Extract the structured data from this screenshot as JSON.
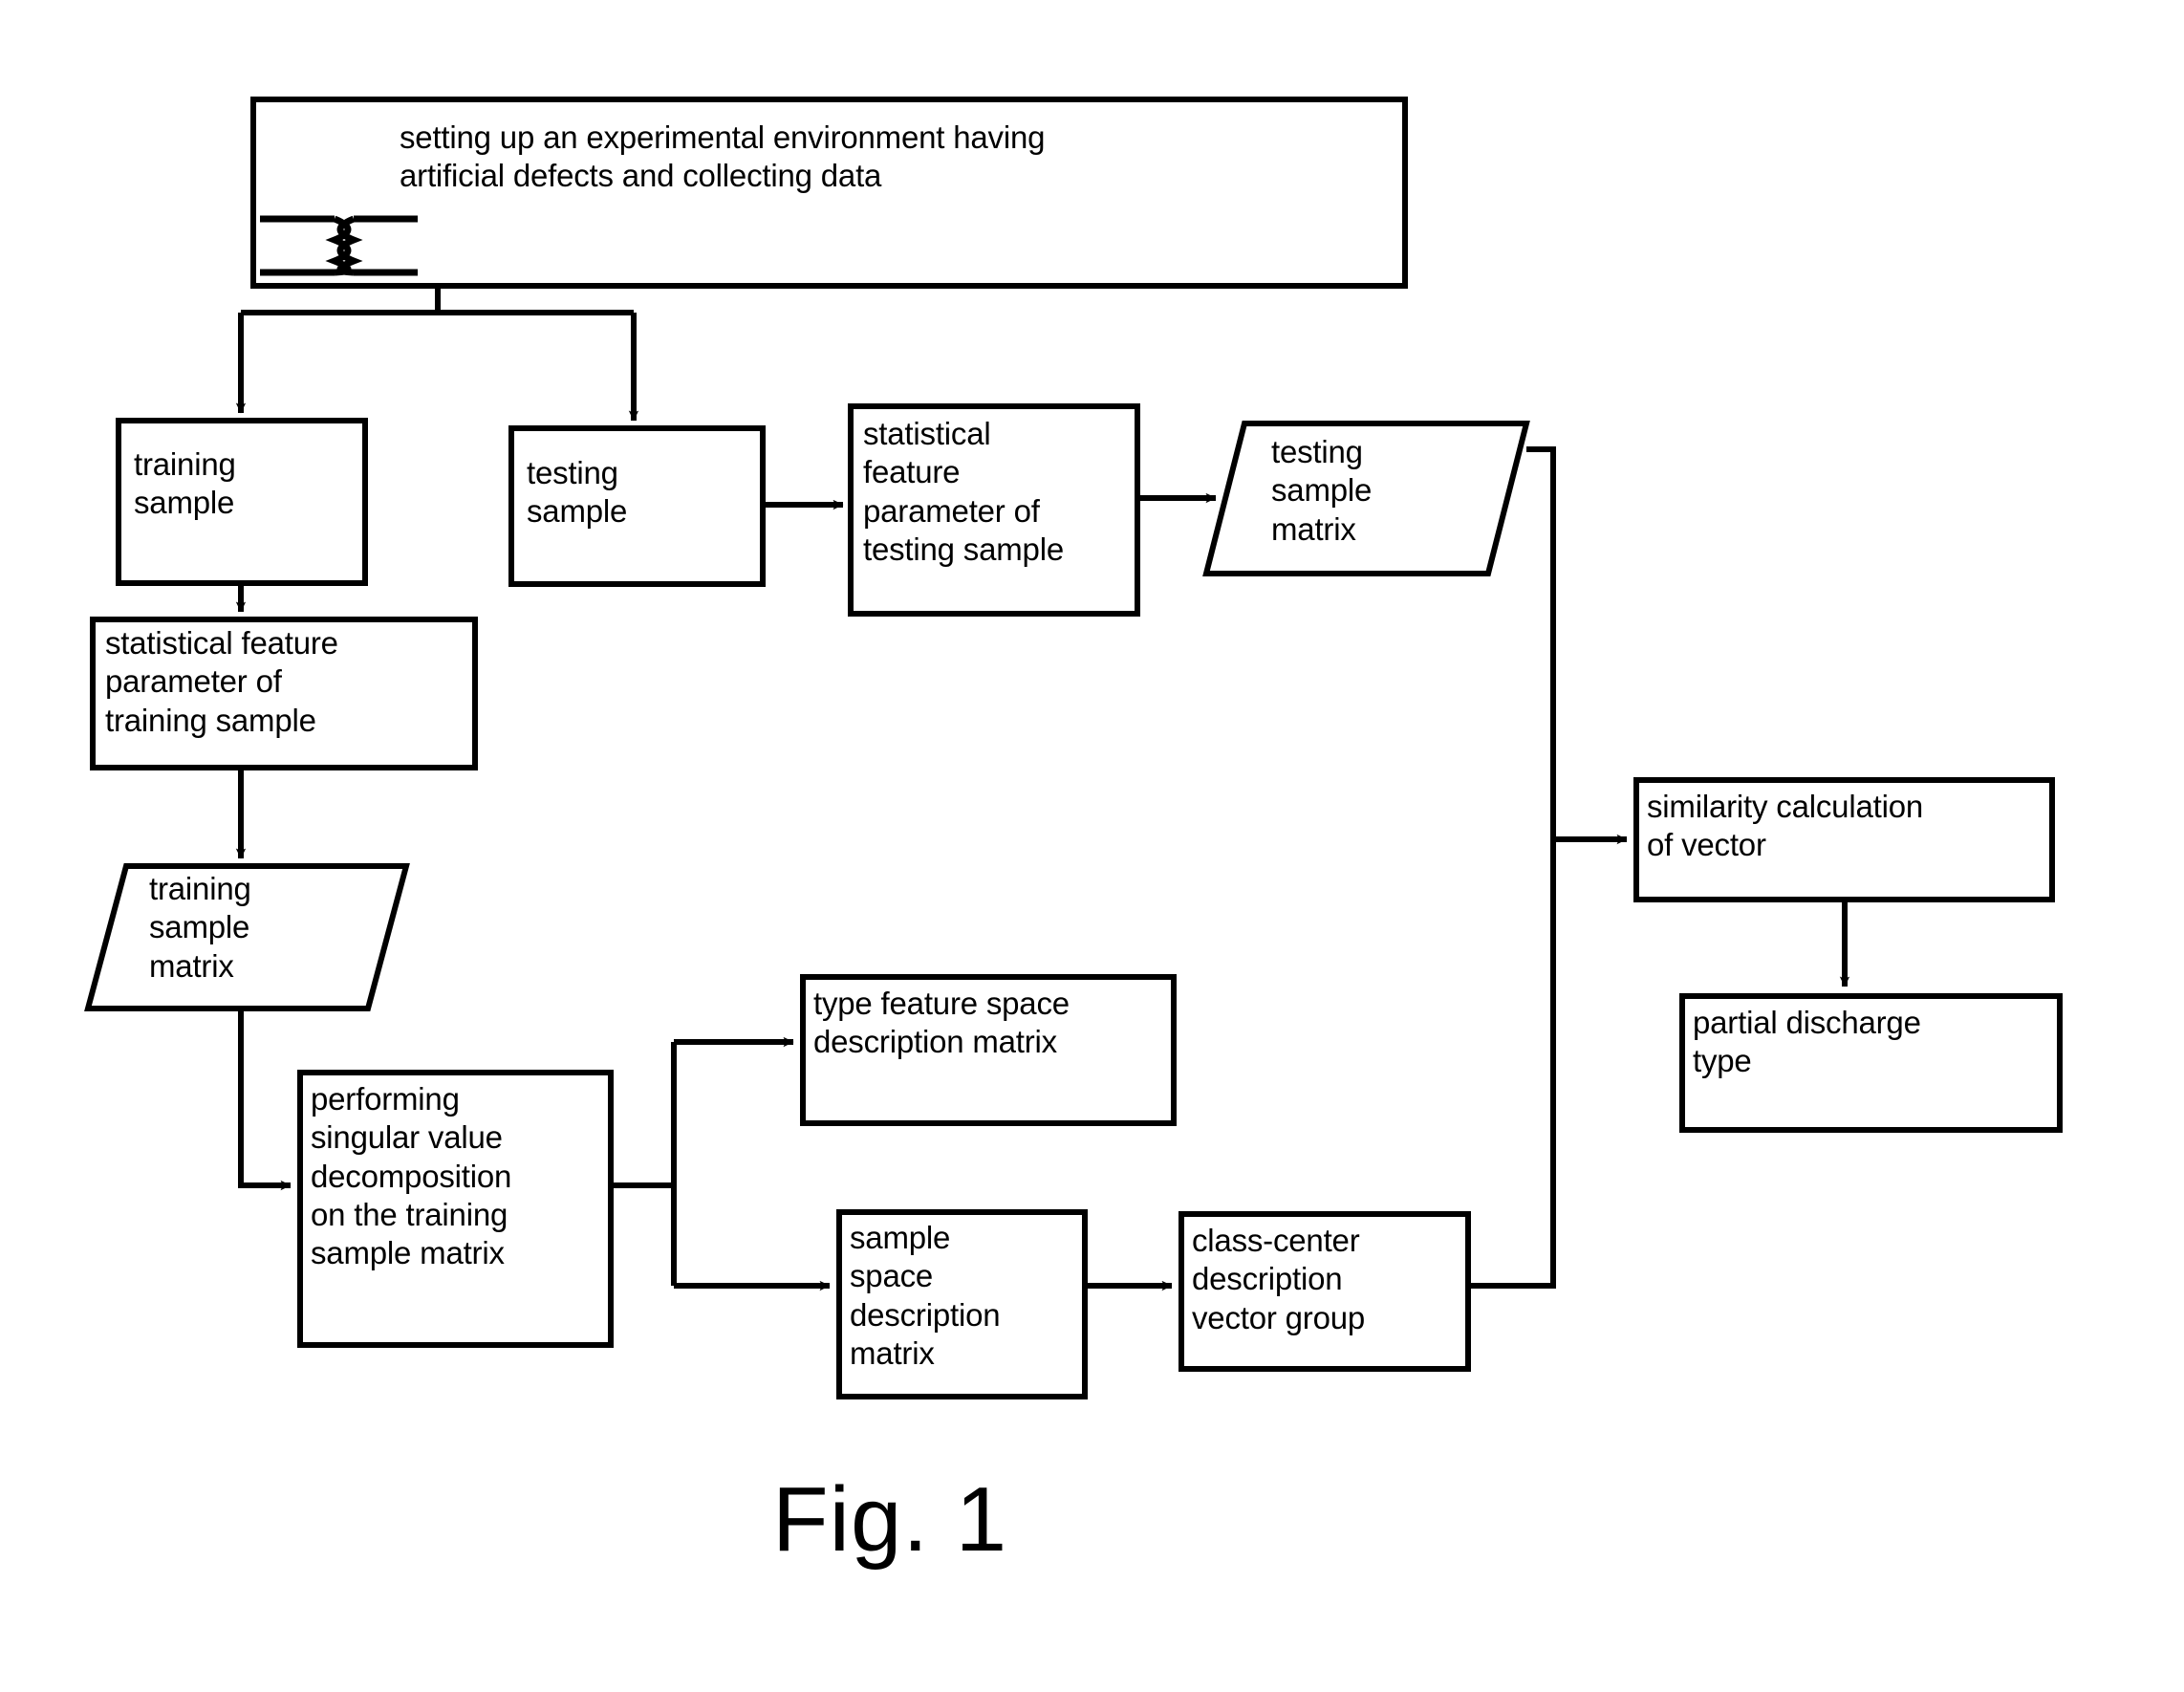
{
  "figure": {
    "caption": "Fig. 1",
    "stroke_color": "#000000",
    "background_color": "#ffffff"
  },
  "nodes": {
    "setup": {
      "label": "setting up an experimental environment having\nartificial defects and collecting data",
      "shape": "rect",
      "icon": "transformer-coil-icon"
    },
    "training_sample": {
      "label": "training\nsample",
      "shape": "rect"
    },
    "testing_sample": {
      "label": "testing\nsample",
      "shape": "rect"
    },
    "stat_feature_testing": {
      "label": "statistical\nfeature\nparameter of\ntesting sample",
      "shape": "rect"
    },
    "testing_sample_matrix": {
      "label": "testing\nsample\nmatrix",
      "shape": "parallelogram"
    },
    "stat_feature_training": {
      "label": "statistical feature\nparameter of\ntraining sample",
      "shape": "rect"
    },
    "training_sample_matrix": {
      "label": "training\nsample\nmatrix",
      "shape": "parallelogram"
    },
    "svd": {
      "label": "performing\nsingular value\ndecomposition\non the training\nsample matrix",
      "shape": "rect"
    },
    "type_feature_space": {
      "label": "type feature space\ndescription matrix",
      "shape": "rect"
    },
    "sample_space": {
      "label": "sample\nspace\ndescription\nmatrix",
      "shape": "rect"
    },
    "class_center": {
      "label": "class-center\ndescription\nvector group",
      "shape": "rect"
    },
    "similarity": {
      "label": "similarity calculation\nof vector",
      "shape": "rect"
    },
    "partial_discharge": {
      "label": "partial discharge\ntype",
      "shape": "rect"
    }
  },
  "edges": [
    {
      "from": "setup",
      "to": "training_sample"
    },
    {
      "from": "setup",
      "to": "testing_sample"
    },
    {
      "from": "testing_sample",
      "to": "stat_feature_testing"
    },
    {
      "from": "stat_feature_testing",
      "to": "testing_sample_matrix"
    },
    {
      "from": "training_sample",
      "to": "stat_feature_training"
    },
    {
      "from": "stat_feature_training",
      "to": "training_sample_matrix"
    },
    {
      "from": "training_sample_matrix",
      "to": "svd"
    },
    {
      "from": "svd",
      "to": "type_feature_space"
    },
    {
      "from": "svd",
      "to": "sample_space"
    },
    {
      "from": "sample_space",
      "to": "class_center"
    },
    {
      "from": "class_center",
      "to": "similarity"
    },
    {
      "from": "testing_sample_matrix",
      "to": "similarity"
    },
    {
      "from": "similarity",
      "to": "partial_discharge"
    }
  ]
}
